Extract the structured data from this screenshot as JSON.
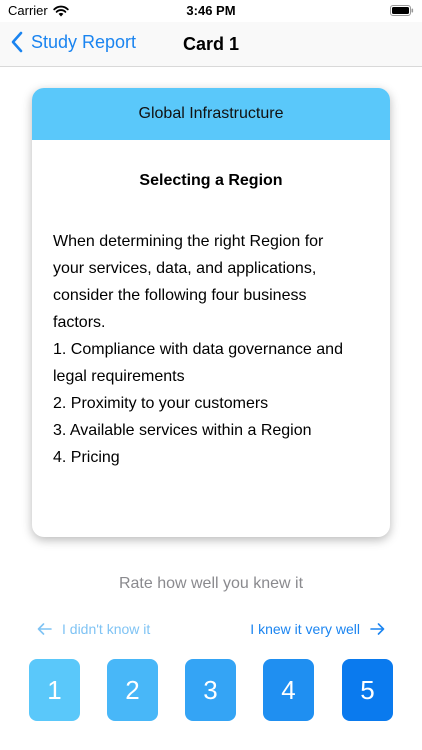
{
  "status_bar": {
    "carrier": "Carrier",
    "time": "3:46 PM"
  },
  "nav": {
    "back_label": "Study Report",
    "title": "Card 1"
  },
  "card": {
    "category": "Global Infrastructure",
    "title": "Selecting a Region",
    "body_lines": [
      "When determining the right Region for",
      "your services, data, and applications,",
      "consider the following four business",
      "factors.",
      "1. Compliance with data governance and",
      "legal requirements",
      "2. Proximity to your customers",
      "3. Available services within a Region",
      "4. Pricing"
    ]
  },
  "rating": {
    "prompt": "Rate how well you knew it",
    "low_hint": "I didn't know it",
    "high_hint": "I knew it very well",
    "buttons": [
      "1",
      "2",
      "3",
      "4",
      "5"
    ]
  },
  "colors": {
    "accent": "#1a84f0",
    "card_header": "#5ac8fa",
    "rating_1": "#5ac8fa",
    "rating_5": "#0a7aee"
  }
}
